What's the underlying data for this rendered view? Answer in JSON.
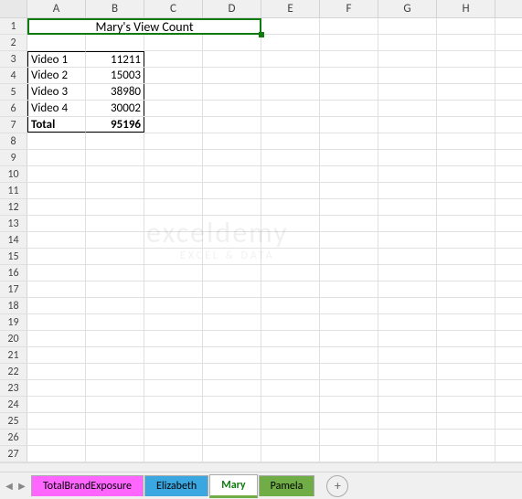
{
  "columns": [
    "A",
    "B",
    "C",
    "D",
    "E",
    "F",
    "G",
    "H"
  ],
  "title": "Mary's View Count",
  "rows": [
    {
      "label": "Video 1",
      "value": "11211"
    },
    {
      "label": "Video 2",
      "value": "15003"
    },
    {
      "label": "Video 3",
      "value": "38980"
    },
    {
      "label": "Video 4",
      "value": "30002"
    }
  ],
  "total": {
    "label": "Total",
    "value": "95196"
  },
  "rowCount": 27,
  "tabs": {
    "t1": "TotalBrandExposure",
    "t2": "Elizabeth",
    "t3": "Mary",
    "t4": "Pamela"
  },
  "watermark": "exceldemy",
  "watermark_sub": "EXCEL & DATA",
  "addTab": "+",
  "chart_data": {
    "type": "table",
    "title": "Mary's View Count",
    "categories": [
      "Video 1",
      "Video 2",
      "Video 3",
      "Video 4"
    ],
    "values": [
      11211,
      15003,
      38980,
      30002
    ],
    "total": 95196
  }
}
